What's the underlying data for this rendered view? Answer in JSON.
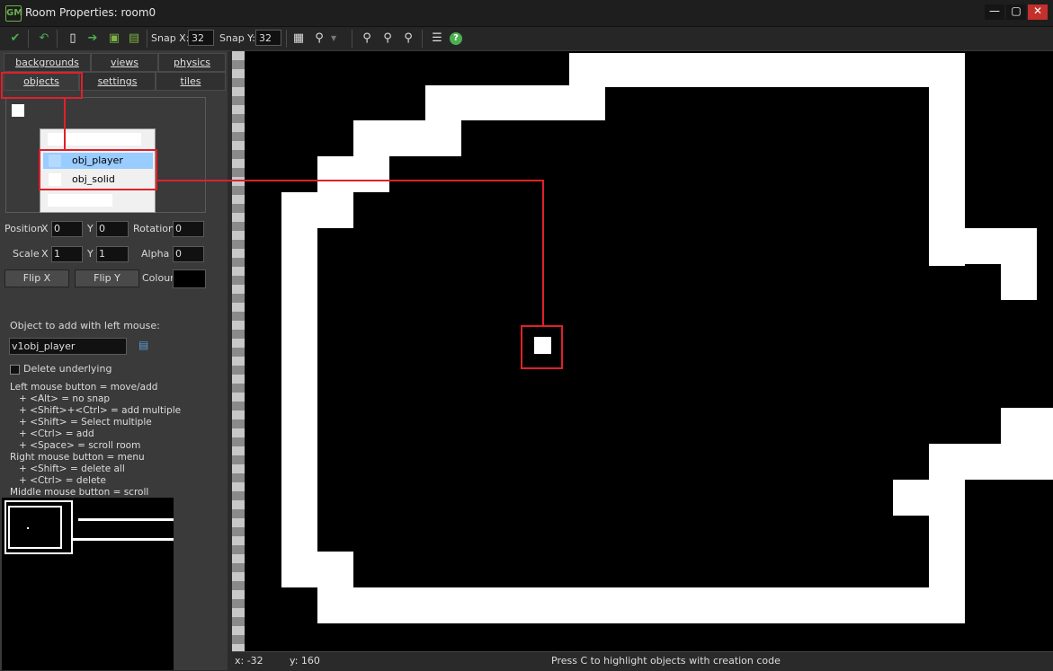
{
  "window": {
    "title": "Room Properties: room0"
  },
  "toolbar": {
    "snap_x_label": "Snap X:",
    "snap_x_value": "32",
    "snap_y_label": "Snap Y:",
    "snap_y_value": "32"
  },
  "tabs": {
    "row1": [
      "backgrounds",
      "views",
      "physics"
    ],
    "row2": [
      "objects",
      "settings",
      "tiles"
    ]
  },
  "object_dropdown": {
    "items": [
      "obj_player",
      "obj_solid"
    ],
    "highlighted": "obj_player"
  },
  "properties": {
    "position_label": "Position",
    "x_label": "X",
    "y_label": "Y",
    "position_x": "0",
    "position_y": "0",
    "rotation_label": "Rotation",
    "rotation": "0",
    "scale_label": "Scale",
    "scale_x": "1",
    "scale_y": "1",
    "alpha_label": "Alpha",
    "alpha": "0",
    "flip_x": "Flip X",
    "flip_y": "Flip Y",
    "colour_label": "Colour",
    "colour_value": "#000000"
  },
  "add_object": {
    "label": "Object to add with left mouse:",
    "value": "v1obj_player",
    "delete_underlying": "Delete underlying"
  },
  "help_text": "Left mouse button = move/add\n   + <Alt> = no snap\n   + <Shift>+<Ctrl> = add multiple\n   + <Shift> = Select multiple\n   + <Ctrl> = add\n   + <Space> = scroll room\nRight mouse button = menu\n   + <Shift> = delete all\n   + <Ctrl> = delete\nMiddle mouse button = scroll",
  "status": {
    "x": "x: -32",
    "y": "y: 160",
    "message": "Press C to highlight objects with creation code"
  },
  "colors": {
    "highlight": "#e0202a",
    "selection": "#99ccff",
    "accent": "#6ab04c"
  }
}
